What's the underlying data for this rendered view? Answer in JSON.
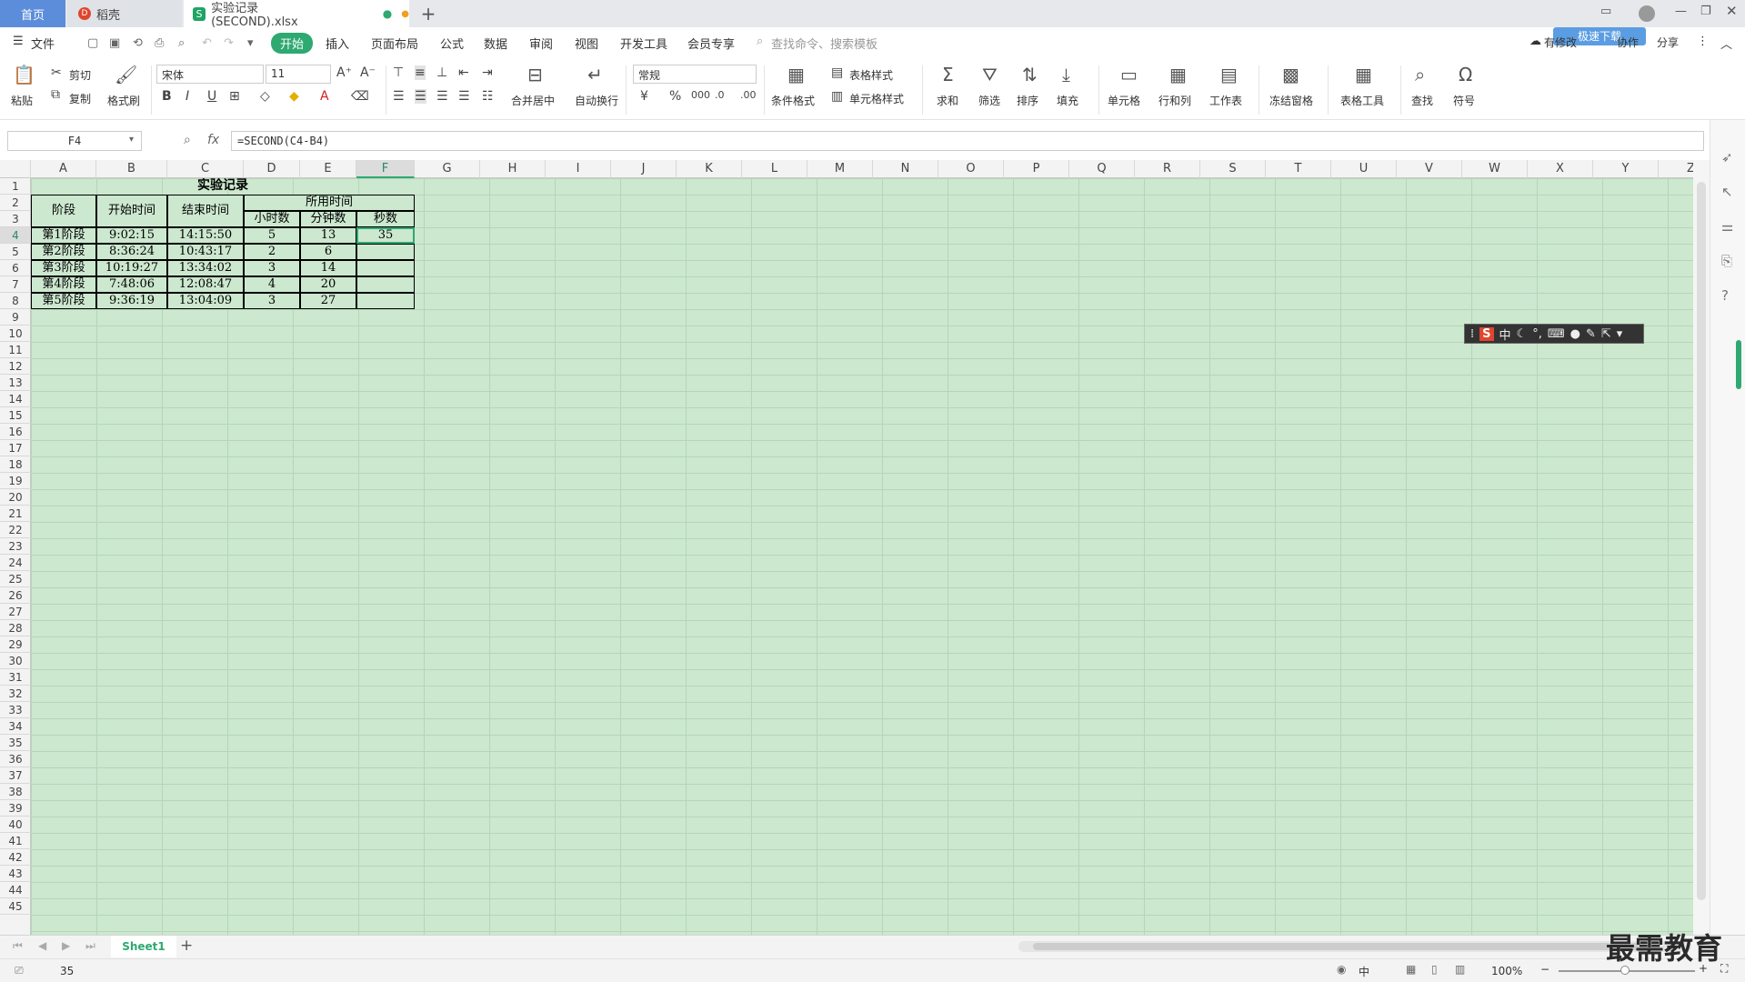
{
  "tabs": {
    "home": "首页",
    "daoke": "稻壳",
    "file": "实验记录(SECOND).xlsx",
    "add": "+"
  },
  "menubar": {
    "file": "文件",
    "items": [
      "开始",
      "插入",
      "页面布局",
      "公式",
      "数据",
      "审阅",
      "视图",
      "开发工具",
      "会员专享"
    ],
    "search_placeholder": "查找命令、搜索模板",
    "right_items": [
      "有修改",
      "协作",
      "分享"
    ],
    "cloud_btn": "极速下载"
  },
  "ribbon": {
    "paste": "粘贴",
    "cut": "剪切",
    "copy": "复制",
    "format_painter": "格式刷",
    "font": "宋体",
    "font_size": "11",
    "merge_center": "合并居中",
    "wrap_text": "自动换行",
    "number_format": "常规",
    "cond_format": "条件格式",
    "table_style": "表格样式",
    "cell_style": "单元格样式",
    "sum": "求和",
    "filter": "筛选",
    "sort": "排序",
    "fill": "填充",
    "cell": "单元格",
    "row_col": "行和列",
    "worksheet": "工作表",
    "freeze": "冻结窗格",
    "table_tool": "表格工具",
    "find": "查找",
    "symbol": "符号"
  },
  "formula_bar": {
    "name_box": "F4",
    "fx": "fx",
    "formula": "=SECOND(C4-B4)"
  },
  "columns": [
    "A",
    "B",
    "C",
    "D",
    "E",
    "F",
    "G",
    "H",
    "I",
    "J",
    "K",
    "L",
    "M",
    "N",
    "O",
    "P",
    "Q",
    "R",
    "S",
    "T",
    "U",
    "V",
    "W",
    "X",
    "Y",
    "Z"
  ],
  "selected_column": "F",
  "rows": [
    "1",
    "2",
    "3",
    "4",
    "5",
    "6",
    "7",
    "8",
    "9",
    "10",
    "11",
    "12",
    "13",
    "14",
    "15",
    "16",
    "17",
    "18",
    "19",
    "20",
    "21",
    "22",
    "23",
    "24",
    "25",
    "26",
    "27",
    "28",
    "29",
    "30",
    "31",
    "32",
    "33",
    "34",
    "35",
    "36",
    "37",
    "38",
    "39",
    "40",
    "41",
    "42",
    "43",
    "44",
    "45"
  ],
  "selected_row": "4",
  "table": {
    "title": "实验记录",
    "h_stage": "阶段",
    "h_start": "开始时间",
    "h_end": "结束时间",
    "h_used": "所用时间",
    "h_hours": "小时数",
    "h_minutes": "分钟数",
    "h_seconds": "秒数",
    "data": [
      [
        "第1阶段",
        "9:02:15",
        "14:15:50",
        "5",
        "13",
        "35"
      ],
      [
        "第2阶段",
        "8:36:24",
        "10:43:17",
        "2",
        "6",
        ""
      ],
      [
        "第3阶段",
        "10:19:27",
        "13:34:02",
        "3",
        "14",
        ""
      ],
      [
        "第4阶段",
        "7:48:06",
        "12:08:47",
        "4",
        "20",
        ""
      ],
      [
        "第5阶段",
        "9:36:19",
        "13:04:09",
        "3",
        "27",
        ""
      ]
    ]
  },
  "ime": {
    "mode": "中"
  },
  "sheet_tabs": {
    "active": "Sheet1",
    "add": "+"
  },
  "status": {
    "value": "35",
    "zoom": "100%",
    "ime": "中"
  },
  "watermark": "最需教育"
}
